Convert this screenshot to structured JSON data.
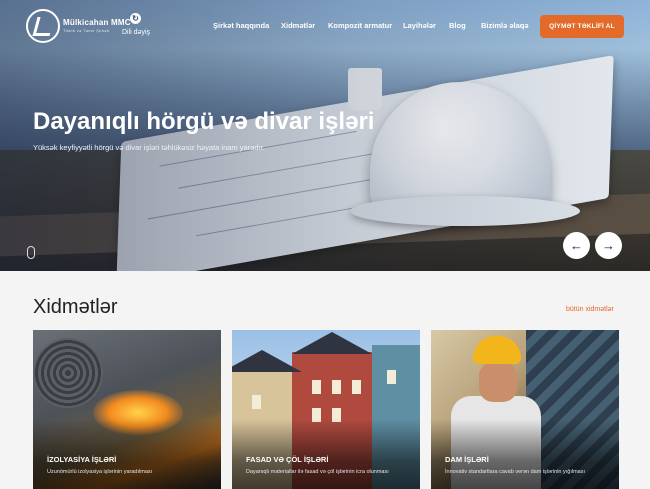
{
  "brand": {
    "name": "Mülkicahan MMC",
    "subtitle": "Tikinti və Təmir Şirkəti"
  },
  "language": {
    "icon": "language-icon",
    "label": "Dili dəyiş"
  },
  "nav": {
    "items": [
      "Şirkət haqqında",
      "Xidmətlər",
      "Kompozit armatur",
      "Layihələr",
      "Blog",
      "Bizimlə əlaqə"
    ],
    "cta": "QİYMƏT TƏKLİFİ AL"
  },
  "hero": {
    "title": "Dayanıqlı hörgü və divar işləri",
    "subtitle": "Yüksək keyfiyyətli hörgü və divar işləri təhlükəsiz həyata inam yaradır.",
    "prev": "←",
    "next": "→"
  },
  "services": {
    "title": "Xidmətlər",
    "all_link": "bütün xidmətlər",
    "cards": [
      {
        "title": "İZOLYASİYA İŞLƏRİ",
        "desc": "Uzunömürlü izolyasiya işlərinin yaradılması"
      },
      {
        "title": "FASAD VƏ ÇÖL İŞLƏRİ",
        "desc": "Dayanıqlı materiallar ilə fasad və çöl işlərinin icra olunması"
      },
      {
        "title": "DAM İŞLƏRİ",
        "desc": "İnnovativ standartlara cavab verən dam işlərinin yığılması"
      }
    ]
  },
  "colors": {
    "accent": "#e46a2a"
  }
}
